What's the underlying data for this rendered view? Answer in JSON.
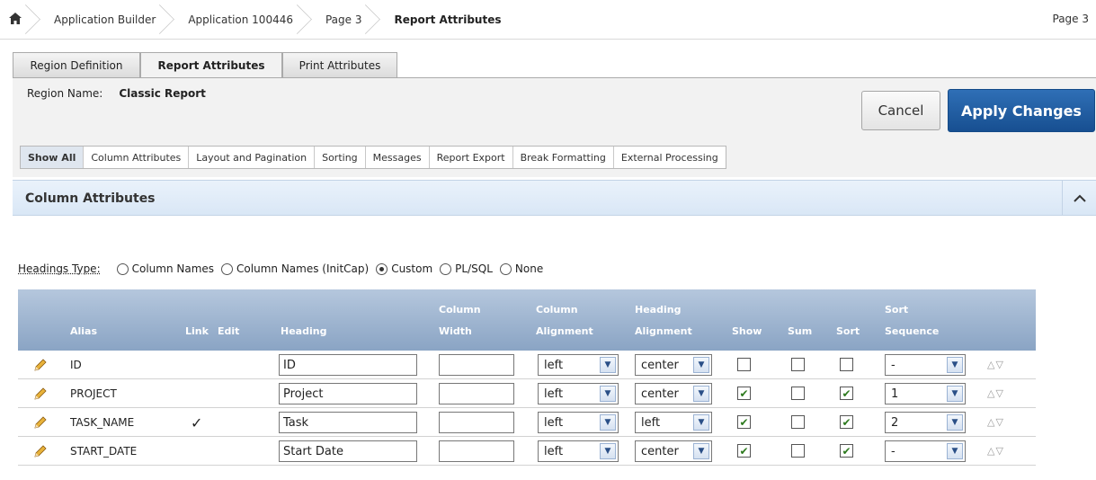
{
  "breadcrumb": {
    "home_icon": "home-icon",
    "items": [
      "Application Builder",
      "Application 100446",
      "Page 3",
      "Report Attributes"
    ],
    "right": "Page 3"
  },
  "tabs": [
    "Region Definition",
    "Report Attributes",
    "Print Attributes"
  ],
  "region": {
    "label": "Region Name:",
    "value": "Classic Report",
    "cancel_label": "Cancel",
    "apply_label": "Apply Changes"
  },
  "subtabs": [
    "Show All",
    "Column Attributes",
    "Layout and Pagination",
    "Sorting",
    "Messages",
    "Report Export",
    "Break Formatting",
    "External Processing"
  ],
  "section": {
    "title": "Column Attributes",
    "collapse_icon": "chevron-up-icon"
  },
  "headings_type": {
    "label": "Headings Type:",
    "options": [
      "Column Names",
      "Column Names (InitCap)",
      "Custom",
      "PL/SQL",
      "None"
    ],
    "selected": "Custom"
  },
  "table": {
    "headers": {
      "alias": "Alias",
      "link": "Link",
      "edit": "Edit",
      "heading": "Heading",
      "col_width_1": "Column",
      "col_width_2": "Width",
      "col_align_1": "Column",
      "col_align_2": "Alignment",
      "head_align_1": "Heading",
      "head_align_2": "Alignment",
      "show": "Show",
      "sum": "Sum",
      "sort": "Sort",
      "sort_seq_1": "Sort",
      "sort_seq_2": "Sequence"
    },
    "rows": [
      {
        "alias": "ID",
        "link": "",
        "heading": "ID",
        "width": "",
        "col_align": "left",
        "head_align": "center",
        "show": false,
        "sum": false,
        "sort": false,
        "seq": "-"
      },
      {
        "alias": "PROJECT",
        "link": "",
        "heading": "Project",
        "width": "",
        "col_align": "left",
        "head_align": "center",
        "show": true,
        "sum": false,
        "sort": true,
        "seq": "1"
      },
      {
        "alias": "TASK_NAME",
        "link": "✓",
        "heading": "Task",
        "width": "",
        "col_align": "left",
        "head_align": "left",
        "show": true,
        "sum": false,
        "sort": true,
        "seq": "2"
      },
      {
        "alias": "START_DATE",
        "link": "",
        "heading": "Start Date",
        "width": "",
        "col_align": "left",
        "head_align": "center",
        "show": true,
        "sum": false,
        "sort": true,
        "seq": "-"
      }
    ],
    "edit_icon": "pencil-icon",
    "move_icons": "up-down-arrow-icons"
  }
}
